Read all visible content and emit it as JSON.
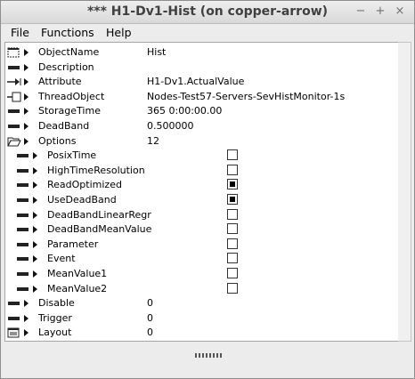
{
  "window": {
    "title": "*** H1-Dv1-Hist (on copper-arrow)",
    "btn_min": "−",
    "btn_max": "+",
    "btn_close": "×"
  },
  "menu": {
    "file": "File",
    "functions": "Functions",
    "help": "Help"
  },
  "attributes": [
    {
      "name": "ObjectName",
      "value": "Hist",
      "icon": "object-icon"
    },
    {
      "name": "Description",
      "value": "",
      "icon": "attribute-icon"
    },
    {
      "name": "Attribute",
      "value": "H1-Dv1.ActualValue",
      "icon": "reference-icon"
    },
    {
      "name": "ThreadObject",
      "value": "Nodes-Test57-Servers-SevHistMonitor-1s",
      "icon": "object-reference-icon"
    },
    {
      "name": "StorageTime",
      "value": "365 0:00:00.00",
      "icon": "attribute-icon"
    },
    {
      "name": "DeadBand",
      "value": "0.500000",
      "icon": "attribute-icon"
    },
    {
      "name": "Options",
      "value": "12",
      "icon": "folder-open-icon"
    }
  ],
  "options": [
    {
      "name": "PosixTime",
      "checked": false
    },
    {
      "name": "HighTimeResolution",
      "checked": false
    },
    {
      "name": "ReadOptimized",
      "checked": true
    },
    {
      "name": "UseDeadBand",
      "checked": true
    },
    {
      "name": "DeadBandLinearRegr",
      "checked": false
    },
    {
      "name": "DeadBandMeanValue",
      "checked": false
    },
    {
      "name": "Parameter",
      "checked": false
    },
    {
      "name": "Event",
      "checked": false
    },
    {
      "name": "MeanValue1",
      "checked": false
    },
    {
      "name": "MeanValue2",
      "checked": false
    }
  ],
  "tail": [
    {
      "name": "Disable",
      "value": "0",
      "icon": "attribute-icon"
    },
    {
      "name": "Trigger",
      "value": "0",
      "icon": "attribute-icon"
    },
    {
      "name": "Layout",
      "value": "0",
      "icon": "layout-icon"
    }
  ]
}
